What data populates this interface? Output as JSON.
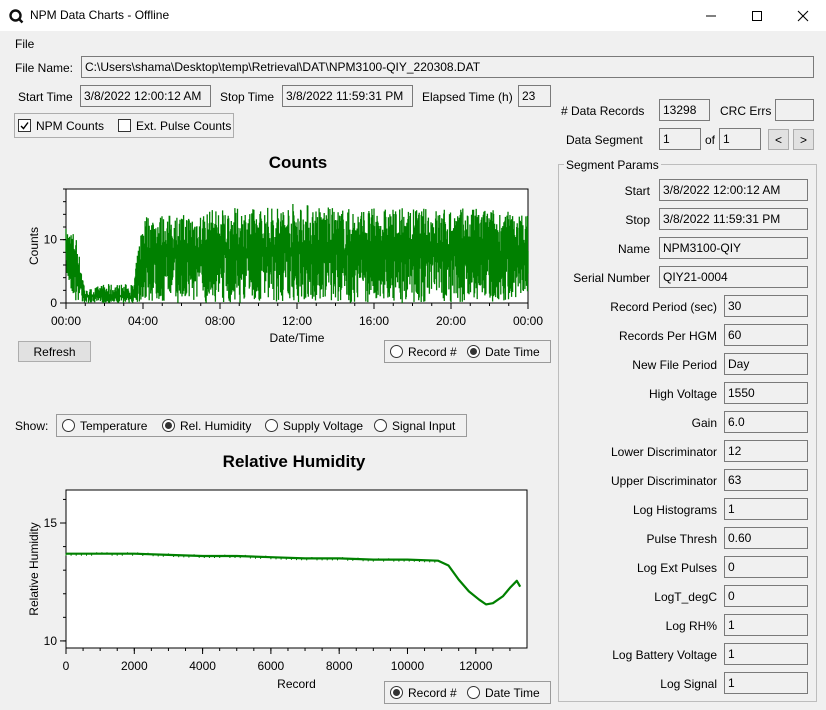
{
  "window": {
    "title": "NPM Data Charts - Offline",
    "controls": [
      "minimize-icon",
      "maximize-icon",
      "close-icon"
    ]
  },
  "menu": {
    "file": "File"
  },
  "file": {
    "name_label": "File Name:",
    "name_value": "C:\\Users\\shama\\Desktop\\temp\\Retrieval\\DAT\\NPM3100-QIY_220308.DAT"
  },
  "times": {
    "start_label": "Start Time",
    "start_value": "3/8/2022 12:00:12 AM",
    "stop_label": "Stop Time",
    "stop_value": "3/8/2022 11:59:31 PM",
    "elapsed_label": "Elapsed Time (h)",
    "elapsed_value": "23"
  },
  "checkboxes": {
    "npm_counts": "NPM Counts",
    "npm_counts_checked": true,
    "ext_pulse": "Ext. Pulse Counts",
    "ext_pulse_checked": false
  },
  "records": {
    "label": "# Data Records",
    "value": "13298",
    "crc_label": "CRC Errs",
    "crc_value": ""
  },
  "segment": {
    "label": "Data Segment",
    "value": "1",
    "of_label": "of",
    "total": "1",
    "prev": "<",
    "next": ">"
  },
  "segment_params": {
    "title": "Segment Params",
    "start_label": "Start",
    "start_value": "3/8/2022 12:00:12 AM",
    "stop_label": "Stop",
    "stop_value": "3/8/2022 11:59:31 PM",
    "name_label": "Name",
    "name_value": "NPM3100-QIY",
    "serial_label": "Serial Number",
    "serial_value": "QIY21-0004",
    "rows": [
      {
        "label": "Record Period (sec)",
        "value": "30"
      },
      {
        "label": "Records Per HGM",
        "value": "60"
      },
      {
        "label": "New File Period",
        "value": "Day"
      },
      {
        "label": "High Voltage",
        "value": "1550"
      },
      {
        "label": "Gain",
        "value": "6.0"
      },
      {
        "label": "Lower Discriminator",
        "value": "12"
      },
      {
        "label": "Upper Discriminator",
        "value": "63"
      },
      {
        "label": "Log Histograms",
        "value": "1"
      },
      {
        "label": "Pulse Thresh",
        "value": "0.60"
      },
      {
        "label": "Log Ext Pulses",
        "value": "0"
      },
      {
        "label": "LogT_degC",
        "value": "0"
      },
      {
        "label": "Log RH%",
        "value": "1"
      },
      {
        "label": "Log Battery Voltage",
        "value": "1"
      },
      {
        "label": "Log Signal",
        "value": "1"
      }
    ]
  },
  "buttons": {
    "refresh": "Refresh"
  },
  "counts_axis_toggle": {
    "record": "Record #",
    "date": "Date Time",
    "selected": "date"
  },
  "show": {
    "label": "Show:",
    "options": [
      "Temperature",
      "Rel. Humidity",
      "Supply Voltage",
      "Signal Input"
    ],
    "selected": 1
  },
  "rh_axis_toggle": {
    "record": "Record #",
    "date": "Date Time",
    "selected": "record"
  },
  "colors": {
    "series": "#008000",
    "panel": "#f0f0f0"
  },
  "chart_data": [
    {
      "type": "line",
      "title": "Counts",
      "xlabel": "Date/Time",
      "ylabel": "Counts",
      "xlim": [
        "00:00",
        "24:00"
      ],
      "xticks": [
        "00:00",
        "04:00",
        "08:00",
        "12:00",
        "16:00",
        "20:00",
        "00:00"
      ],
      "ylim": [
        0,
        18
      ],
      "yticks": [
        0,
        10
      ],
      "series": [
        {
          "x": [
            "00:00",
            "00:30",
            "01:00",
            "02:00",
            "03:00",
            "03:30",
            "04:00",
            "06:00",
            "08:00",
            "10:00",
            "12:00",
            "14:00",
            "16:00",
            "18:00",
            "20:00",
            "22:00",
            "24:00"
          ],
          "y": [
            8,
            7,
            1,
            1,
            1,
            1,
            8,
            8,
            8,
            8,
            8,
            8,
            8,
            8,
            8,
            8,
            8
          ],
          "y_min": [
            4,
            0,
            0,
            0,
            0,
            0,
            0,
            0,
            0,
            0,
            0,
            0,
            0,
            0,
            0,
            0,
            1
          ],
          "y_max": [
            12,
            11,
            2,
            3,
            3,
            3,
            14,
            14,
            15,
            15,
            16,
            15,
            15,
            15,
            15,
            15,
            14
          ]
        }
      ],
      "grid": false
    },
    {
      "type": "line",
      "title": "Relative Humidity",
      "xlabel": "Record",
      "ylabel": "Relative Humidity",
      "xlim": [
        0,
        13500
      ],
      "xticks": [
        0,
        2000,
        4000,
        6000,
        8000,
        10000,
        12000
      ],
      "ylim": [
        9.7,
        16.4
      ],
      "yticks": [
        10,
        15
      ],
      "series": [
        {
          "x": [
            0,
            1000,
            2000,
            3000,
            4000,
            5000,
            6000,
            7000,
            8000,
            9000,
            10000,
            10900,
            11200,
            11500,
            11800,
            12100,
            12300,
            12500,
            12800,
            13000,
            13200,
            13300
          ],
          "y": [
            13.7,
            13.7,
            13.7,
            13.65,
            13.6,
            13.6,
            13.55,
            13.5,
            13.5,
            13.45,
            13.45,
            13.4,
            13.2,
            12.6,
            12.1,
            11.75,
            11.55,
            11.6,
            11.9,
            12.25,
            12.55,
            12.3
          ]
        }
      ],
      "grid": false
    }
  ]
}
